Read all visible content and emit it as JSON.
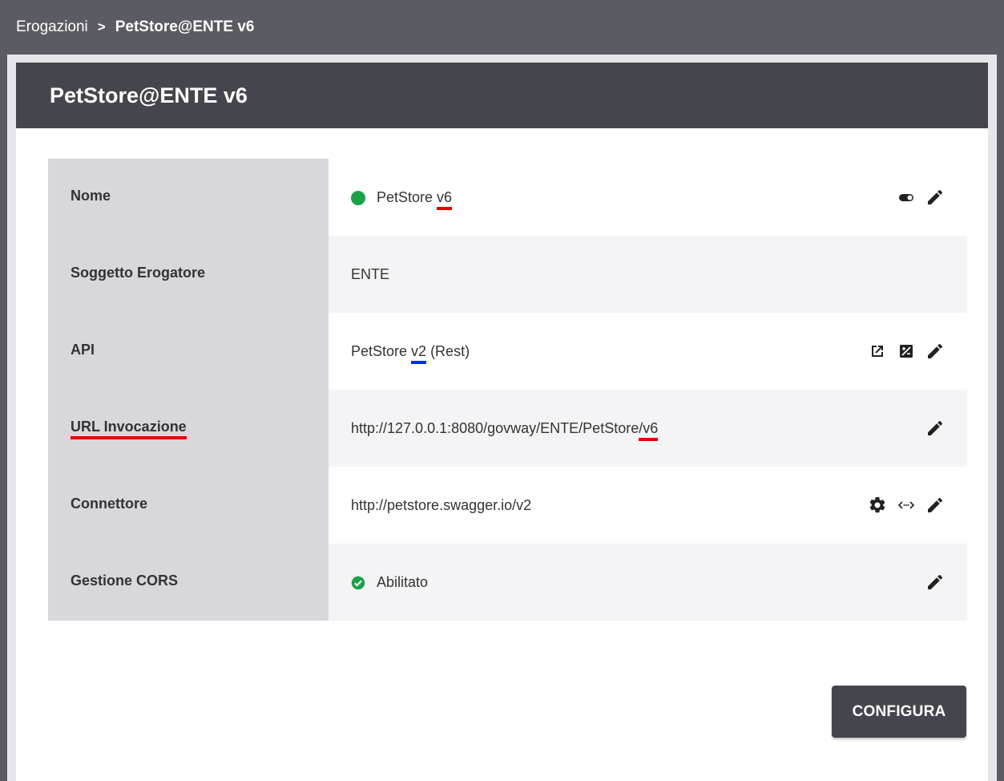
{
  "breadcrumb": {
    "parent": "Erogazioni",
    "separator": ">",
    "current": "PetStore@ENTE v6"
  },
  "header": {
    "title": "PetStore@ENTE v6"
  },
  "rows": {
    "nome": {
      "label": "Nome",
      "value_prefix": "PetStore ",
      "value_highlight": "v6",
      "status": "active"
    },
    "soggetto": {
      "label": "Soggetto Erogatore",
      "value": "ENTE"
    },
    "api": {
      "label": "API",
      "value_prefix": "PetStore ",
      "value_highlight": "v2",
      "value_suffix": " (Rest)"
    },
    "url": {
      "label": "URL Invocazione",
      "value_prefix": "http://127.0.0.1:8080/govway/ENTE/PetStore",
      "value_highlight": "/v6"
    },
    "connettore": {
      "label": "Connettore",
      "value": "http://petstore.swagger.io/v2"
    },
    "cors": {
      "label": "Gestione CORS",
      "value": "Abilitato"
    }
  },
  "actions": {
    "configure_label": "CONFIGURA"
  },
  "colors": {
    "accent_red": "#e60000",
    "accent_blue": "#0030e6",
    "status_green": "#1aa24b",
    "header_dark": "#45464d"
  }
}
